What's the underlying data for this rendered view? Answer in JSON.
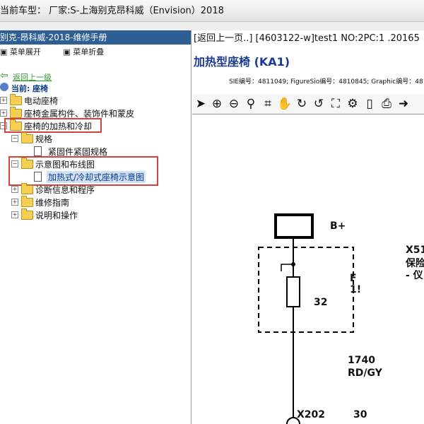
{
  "window": {
    "title": "当前车型： 厂家:S-上海别克昂科威（Envision）2018"
  },
  "left_panel": {
    "header": "别克-昂科威-2018-维修手册",
    "expand_label": "菜单展开",
    "collapse_label": "菜单折叠",
    "back_link": "返回上一级",
    "current_prefix": "当前:",
    "current_value": "座椅",
    "tree": [
      {
        "label": "电动座椅",
        "state": "+",
        "depth": 0
      },
      {
        "label": "座椅金属构件、装饰件和蒙皮",
        "state": "+",
        "depth": 0
      },
      {
        "label": "座椅的加热和冷却",
        "state": "-",
        "depth": 0,
        "highlight": true
      },
      {
        "label": "规格",
        "state": "-",
        "depth": 1
      },
      {
        "label": "紧固件紧固规格",
        "state": "",
        "depth": 2,
        "leaf": true
      },
      {
        "label": "示意图和布线图",
        "state": "-",
        "depth": 1,
        "highlight": true
      },
      {
        "label": "加热式/冷却式座椅示意图",
        "state": "",
        "depth": 2,
        "leaf": true,
        "selected": true
      },
      {
        "label": "诊断信息和程序",
        "state": "+",
        "depth": 1
      },
      {
        "label": "维修指南",
        "state": "+",
        "depth": 1
      },
      {
        "label": "说明和操作",
        "state": "+",
        "depth": 1
      }
    ]
  },
  "right_panel": {
    "nav_text": "[返回上一页..] [4603122-w]test1 NO:2PC:1 .20165",
    "doc_title": "加热型座椅 (KA1)",
    "meta_text": "SIE编号：4811049; FigureSio编号：4810845; Graphic编号：481",
    "toolbar_icons": [
      "pointer-icon",
      "zoom-in-icon",
      "zoom-out-icon",
      "search-icon",
      "crop-icon",
      "hand-icon",
      "rotate-icon",
      "refresh-icon",
      "fit-icon",
      "settings-icon",
      "page-icon",
      "print-icon",
      "forward-icon"
    ],
    "diagram": {
      "b_plus": "B+",
      "fuse_number": "32",
      "fuse_side_letter": "F",
      "fuse_side_digits": "1!",
      "connector_right": "X51",
      "right_label_1": "保险",
      "right_label_2": "- 仪",
      "wire_number": "1740",
      "wire_color": "RD/GY",
      "connector_bottom": "X202",
      "pin_number": "30"
    }
  }
}
